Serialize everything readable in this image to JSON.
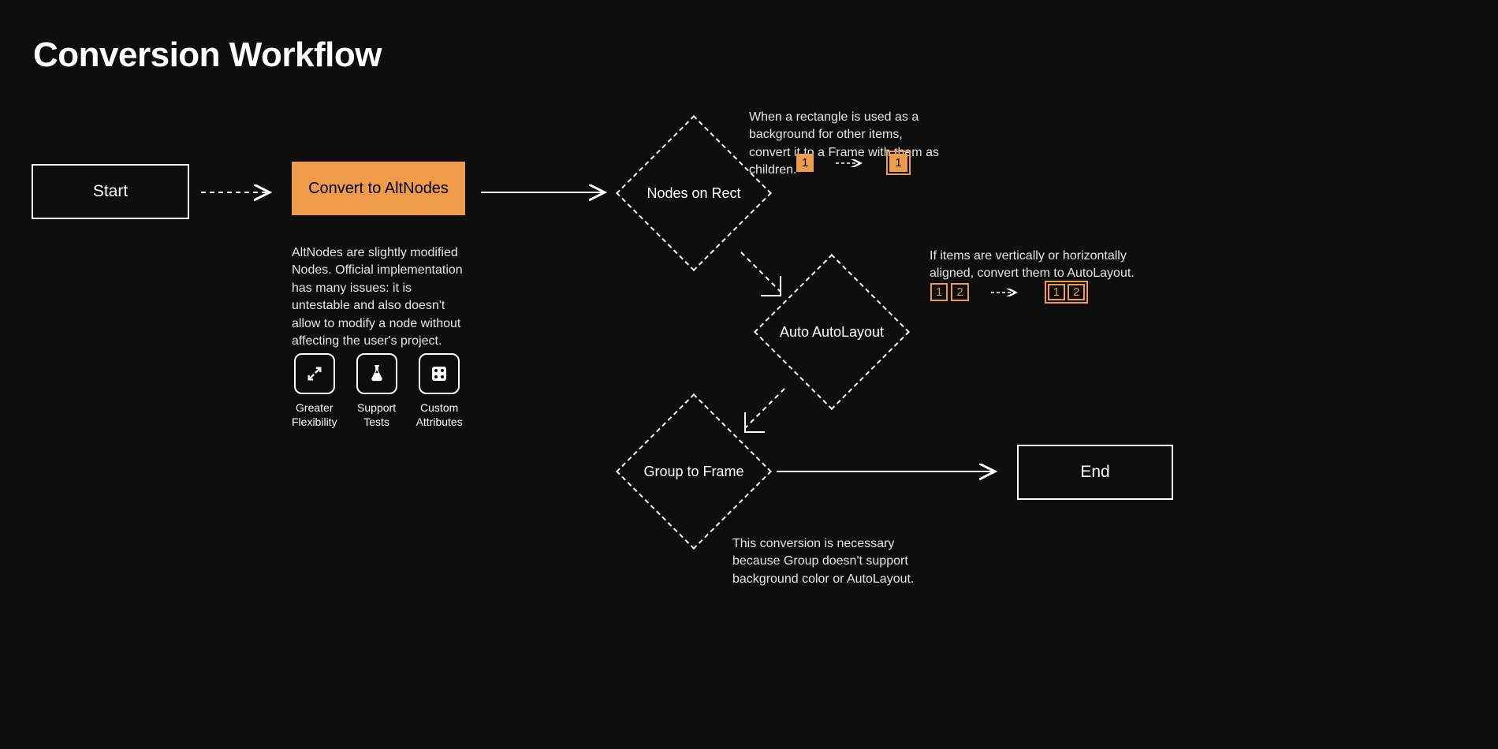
{
  "title": "Conversion Workflow",
  "nodes": {
    "start": "Start",
    "convert": "Convert to AltNodes",
    "nodesOnRect": "Nodes on Rect",
    "autoLayout": "Auto AutoLayout",
    "groupToFrame": "Group to Frame",
    "end": "End"
  },
  "descriptions": {
    "altnodes": "AltNodes are slightly modified Nodes. Official implementation has many issues: it is untestable and also doesn't allow to modify a node without affecting the user's project.",
    "nodesOnRect": "When a rectangle is used as a background for other items, convert it to a Frame with them as children.",
    "autoLayout": "If items are vertically or horizontally aligned, convert them to AutoLayout.",
    "groupToFrame": "This conversion is necessary because Group doesn't support background color or AutoLayout."
  },
  "features": [
    {
      "label": "Greater\nFlexibility",
      "icon": "expand-icon"
    },
    {
      "label": "Support\nTests",
      "icon": "flask-icon"
    },
    {
      "label": "Custom\nAttributes",
      "icon": "dice-icon"
    }
  ],
  "miniExamples": {
    "rect": {
      "before": "1",
      "after": "1"
    },
    "auto": {
      "before": [
        "1",
        "2"
      ],
      "after": [
        "1",
        "2"
      ]
    }
  },
  "colors": {
    "accent": "#ee9c4a",
    "background": "#0d0d0d",
    "foreground": "#ffffff"
  }
}
